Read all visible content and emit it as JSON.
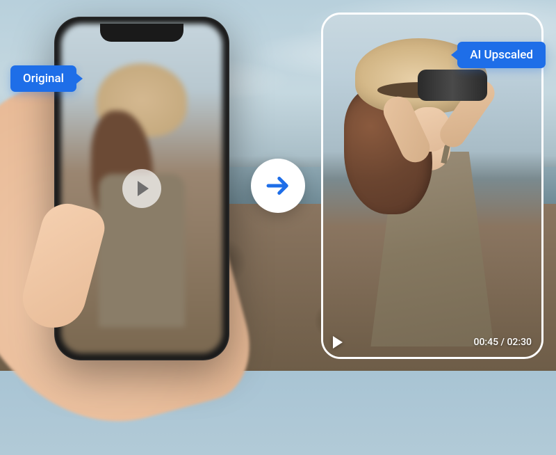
{
  "labels": {
    "original": "Original",
    "upscaled": "AI Upscaled"
  },
  "video": {
    "current_time": "00:45",
    "total_time": "02:30",
    "separator": " / "
  },
  "colors": {
    "accent": "#1e6ee8",
    "frame": "#ffffff"
  },
  "icons": {
    "arrow": "arrow-right",
    "play_large": "play-circle",
    "play_small": "play"
  }
}
